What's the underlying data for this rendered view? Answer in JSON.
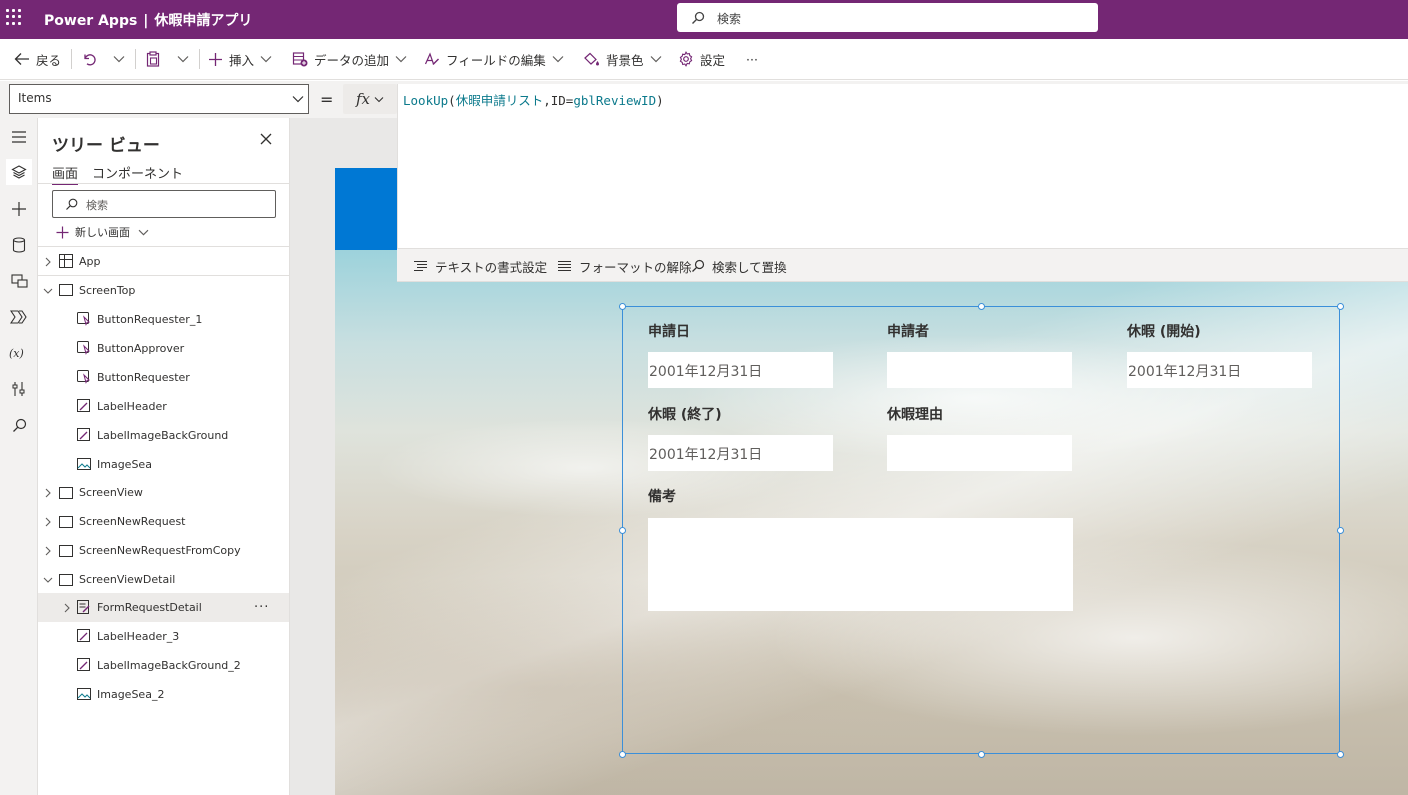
{
  "topbar": {
    "product": "Power Apps",
    "separator": "|",
    "app_name": "休暇申請アプリ",
    "search_placeholder": "検索"
  },
  "commandbar": {
    "back": "戻る",
    "insert": "挿入",
    "add_data": "データの追加",
    "edit_fields": "フィールドの編集",
    "background_color": "背景色",
    "settings": "設定",
    "more": "···"
  },
  "formula_bar": {
    "property": "Items",
    "equals": "=",
    "fx": "fx",
    "formula": {
      "fn": "LookUp",
      "open": "(",
      "source": "休暇申請リスト",
      "comma": ",",
      "cond": "ID=",
      "var": "gblReviewID",
      "close": ")"
    },
    "tools": {
      "format_text": "テキストの書式設定",
      "remove_format": "フォーマットの解除",
      "find_replace": "検索して置換"
    }
  },
  "tree": {
    "title": "ツリー ビュー",
    "tabs": [
      "画面",
      "コンポーネント"
    ],
    "search_placeholder": "検索",
    "new_screen": "新しい画面",
    "nodes": [
      {
        "label": "App"
      },
      {
        "label": "ScreenTop"
      },
      {
        "label": "ButtonRequester_1"
      },
      {
        "label": "ButtonApprover"
      },
      {
        "label": "ButtonRequester"
      },
      {
        "label": "LabelHeader"
      },
      {
        "label": "LabelImageBackGround"
      },
      {
        "label": "ImageSea"
      },
      {
        "label": "ScreenView"
      },
      {
        "label": "ScreenNewRequest"
      },
      {
        "label": "ScreenNewRequestFromCopy"
      },
      {
        "label": "ScreenViewDetail"
      },
      {
        "label": "FormRequestDetail"
      },
      {
        "label": "LabelHeader_3"
      },
      {
        "label": "LabelImageBackGround_2"
      },
      {
        "label": "ImageSea_2"
      }
    ],
    "more": "···"
  },
  "form": {
    "fields": {
      "request_date": {
        "label": "申請日",
        "value": "2001年12月31日"
      },
      "requester": {
        "label": "申請者",
        "value": ""
      },
      "leave_start": {
        "label": "休暇 (開始)",
        "value": "2001年12月31日"
      },
      "leave_end": {
        "label": "休暇 (終了)",
        "value": "2001年12月31日"
      },
      "leave_reason": {
        "label": "休暇理由",
        "value": ""
      },
      "remarks": {
        "label": "備考",
        "value": ""
      }
    }
  },
  "colors": {
    "brand": "#742774",
    "header_blue": "#0078d4",
    "selection": "#3b8fd9"
  }
}
